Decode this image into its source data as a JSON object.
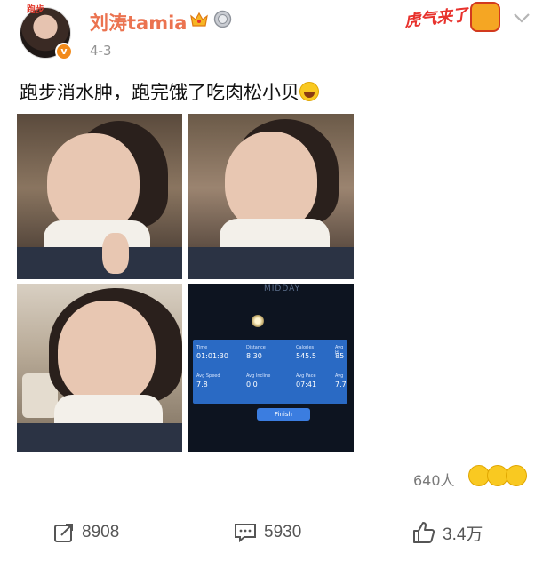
{
  "post": {
    "avatar_tag": "跑步",
    "verified_mark": "v",
    "username": "刘涛tamia",
    "date": "4-3",
    "sticker_text": "虎气来了",
    "text": "跑步消水肿，跑完饿了吃肉松小贝",
    "photos_alt": [
      "selfie-1",
      "selfie-2",
      "selfie-3",
      "treadmill-screen"
    ]
  },
  "treadmill": {
    "brand": "MIDDAY",
    "labels": [
      "Time",
      "Distance",
      "Calories",
      "Avg Hi",
      "Avg Speed",
      "Avg Incline",
      "Avg Pace",
      "Avg"
    ],
    "values": [
      "01:01:30",
      "8.30",
      "545.5",
      "85",
      "7.8",
      "0.0",
      "07:41",
      "7.7"
    ],
    "finish_label": "Finish"
  },
  "engagement": {
    "likers_count": "640人",
    "reaction_emojis": [
      "surprised-emoji",
      "laugh-emoji",
      "grin-emoji"
    ],
    "share_count": "8908",
    "comment_count": "5930",
    "like_count": "3.4万"
  },
  "colors": {
    "username": "#eb7350",
    "date": "#939393",
    "verified": "#f28a1a",
    "action_text": "#555555"
  }
}
